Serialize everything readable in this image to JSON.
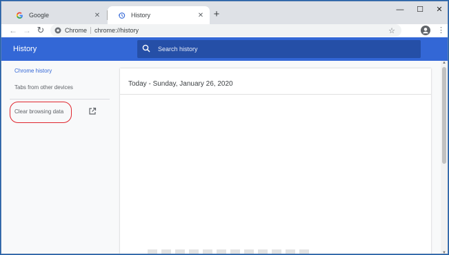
{
  "tabs": [
    {
      "title": "Google",
      "icon": "google-favicon",
      "active": false
    },
    {
      "title": "History",
      "icon": "history-icon",
      "active": true
    }
  ],
  "toolbar": {
    "site_label": "Chrome",
    "url": "chrome://history"
  },
  "history": {
    "header_title": "History",
    "search_placeholder": "Search history",
    "sidebar": {
      "chrome_history": "Chrome history",
      "tabs_other_devices": "Tabs from other devices",
      "clear_browsing_data": "Clear browsing data"
    },
    "date_heading": "Today - Sunday, January 26, 2020"
  },
  "colors": {
    "accent": "#3367d6",
    "header": "#3367d6",
    "search_bg": "#254fa7",
    "annotation": "#e0242c"
  }
}
